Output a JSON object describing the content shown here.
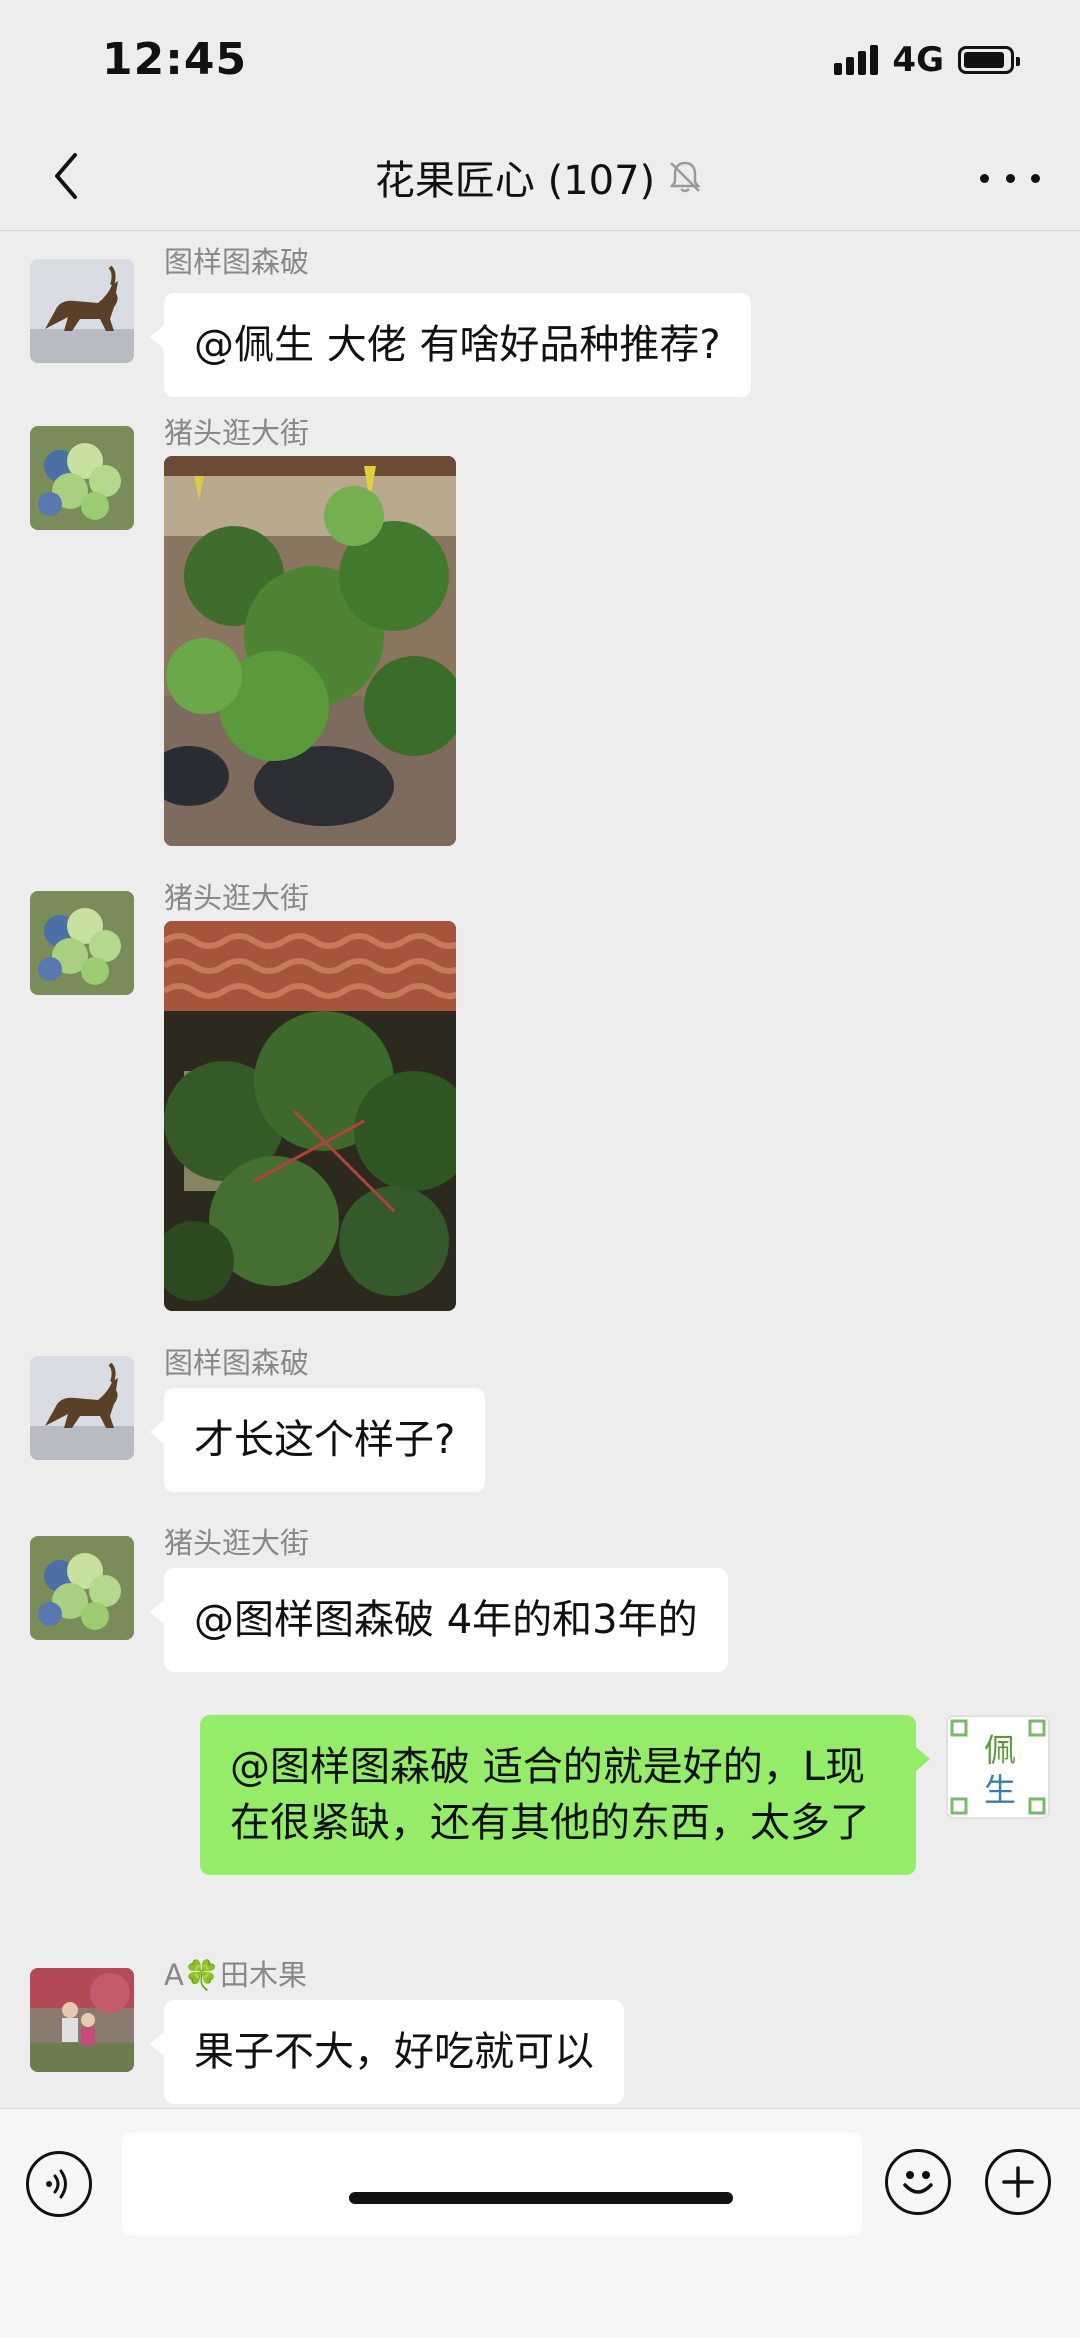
{
  "status_bar": {
    "time": "12:45",
    "network": "4G",
    "signal_icon": "signal-bars-icon",
    "battery_icon": "battery-icon"
  },
  "nav": {
    "back_icon": "chevron-left-icon",
    "title": "花果匠心 (107)",
    "mute_icon": "bell-muted-icon",
    "more_icon": "ellipsis-icon"
  },
  "messages": [
    {
      "sender": "图样图森破",
      "text": "@佩生  大佬 有啥好品种推荐?"
    },
    {
      "sender": "猪头逛大街",
      "image": "plant-photo-1"
    },
    {
      "sender": "猪头逛大街",
      "image": "plant-photo-2"
    },
    {
      "sender": "图样图森破",
      "text": "才长这个样子?"
    },
    {
      "sender": "猪头逛大街",
      "text": "@图样图森破 4年的和3年的"
    },
    {
      "sender": "",
      "self": true,
      "text": "@图样图森破 适合的就是好的，L现在很紧缺，还有其他的东西，太多了",
      "avatar_text": "佩生"
    },
    {
      "sender": "A🍀田木果",
      "text": "果子不大，好吃就可以"
    }
  ],
  "input_bar": {
    "voice_icon": "voice-icon",
    "emoji_icon": "emoji-icon",
    "plus_icon": "plus-icon",
    "placeholder": ""
  },
  "colors": {
    "background": "#ededed",
    "bubble_other": "#ffffff",
    "bubble_self": "#95ec69"
  }
}
